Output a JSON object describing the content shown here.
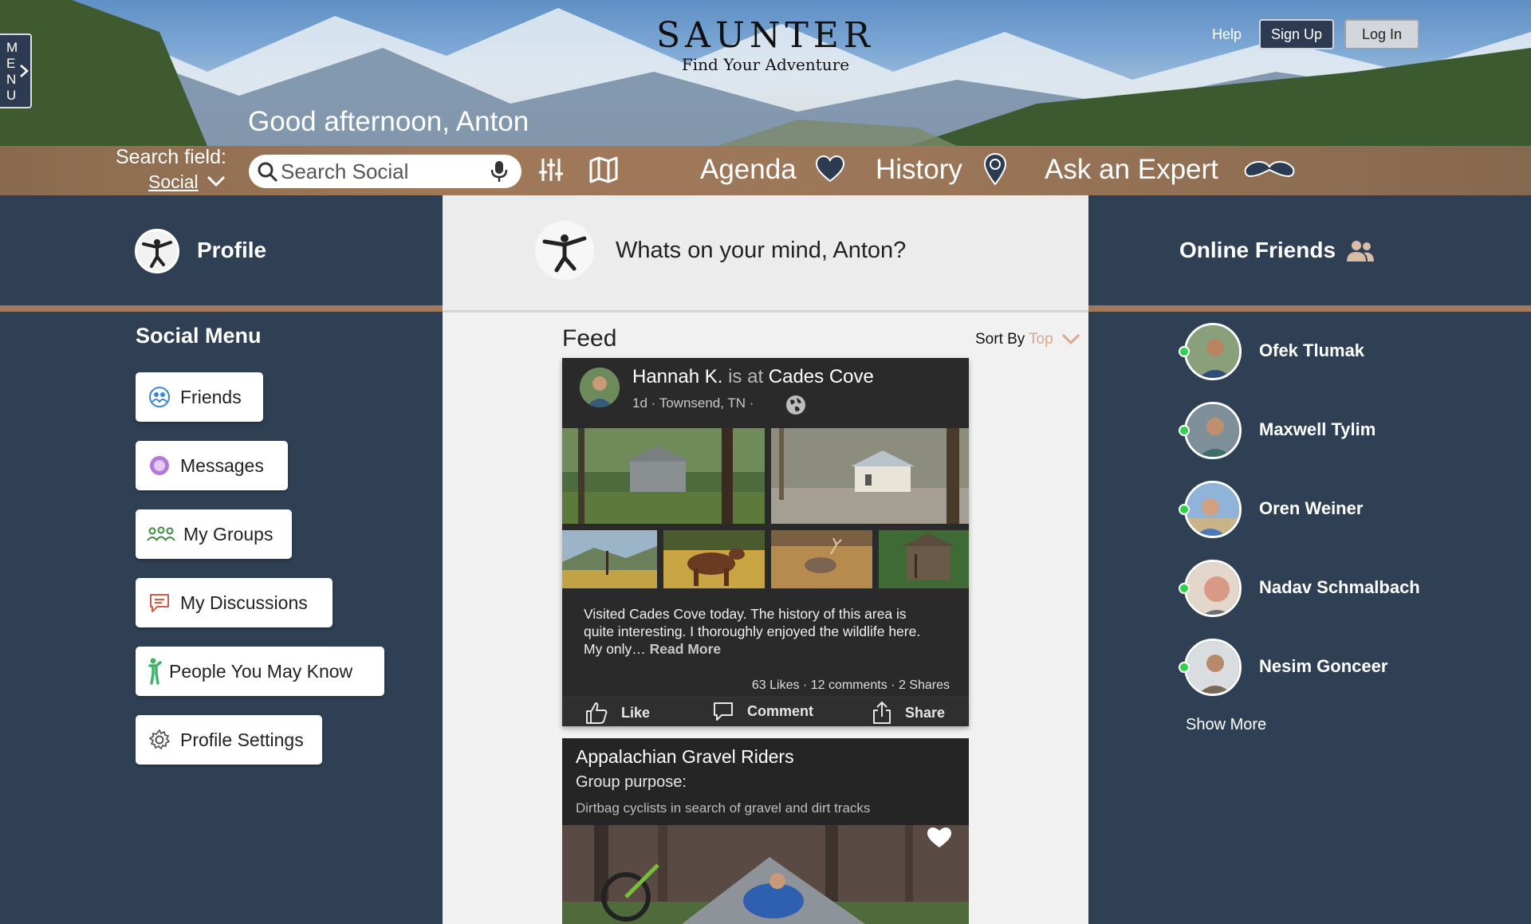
{
  "header": {
    "menu_letters": [
      "M",
      "E",
      "N",
      "U"
    ],
    "brand": "SAUNTER",
    "tagline": "Find Your Adventure",
    "help": "Help",
    "sign_up": "Sign Up",
    "log_in": "Log In",
    "greeting": "Good afternoon, Anton"
  },
  "nav": {
    "search_field_label": "Search field:",
    "search_field_value": "Social",
    "search_placeholder": "Search Social",
    "agenda": "Agenda",
    "history": "History",
    "ask_expert": "Ask an Expert"
  },
  "left": {
    "profile": "Profile",
    "social_menu_title": "Social Menu",
    "menu": [
      {
        "label": "Friends",
        "icon": "friends-icon"
      },
      {
        "label": "Messages",
        "icon": "messages-icon"
      },
      {
        "label": "My Groups",
        "icon": "groups-icon"
      },
      {
        "label": "My Discussions",
        "icon": "discussions-icon"
      },
      {
        "label": "People You May Know",
        "icon": "person-icon"
      },
      {
        "label": "Profile Settings",
        "icon": "gear-icon"
      }
    ]
  },
  "center": {
    "composer_prompt": "Whats on your mind, Anton?",
    "feed_title": "Feed",
    "sort_label": "Sort By",
    "sort_value": "Top",
    "post": {
      "author": "Hannah K.",
      "is_at": "is at",
      "place": "Cades Cove",
      "meta": "1d · Townsend, TN ·",
      "text": "Visited Cades Cove today. The history of this area is quite interesting. I thoroughly enjoyed the wildlife here. My only…",
      "read_more": "Read More",
      "stats": "63 Likes · 12 comments · 2 Shares",
      "like": "Like",
      "comment": "Comment",
      "share": "Share"
    },
    "group": {
      "name": "Appalachian Gravel Riders",
      "purpose_label": "Group purpose:",
      "purpose": "Dirtbag cyclists in search of gravel and dirt tracks"
    }
  },
  "right": {
    "title": "Online Friends",
    "friends": [
      {
        "name": "Ofek Tlumak"
      },
      {
        "name": "Maxwell Tylim"
      },
      {
        "name": "Oren Weiner"
      },
      {
        "name": "Nadav Schmalbach"
      },
      {
        "name": "Nesim Gonceer"
      }
    ],
    "show_more": "Show More"
  },
  "colors": {
    "panel": "#2f3f54",
    "accent_brown": "#a0795a",
    "online_green": "#2fd24b",
    "sort_accent": "#d7a98e"
  }
}
